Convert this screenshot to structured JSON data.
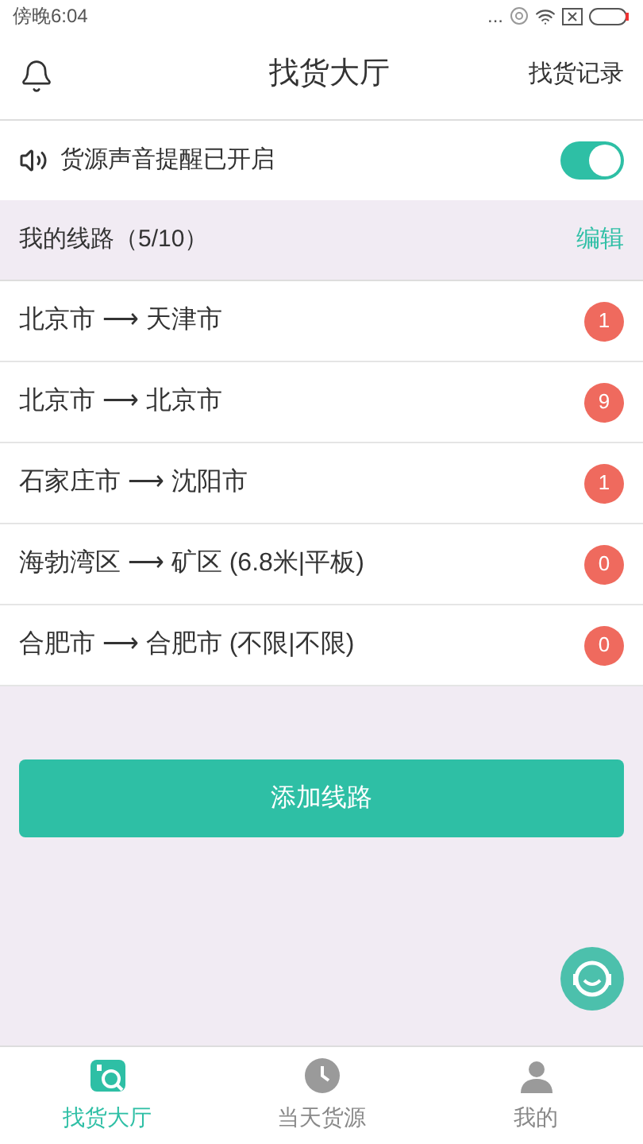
{
  "status_bar": {
    "time": "傍晚6:04",
    "dots": "..."
  },
  "header": {
    "title": "找货大厅",
    "action": "找货记录"
  },
  "sound_alert": {
    "label": "货源声音提醒已开启",
    "on": true
  },
  "routes_header": {
    "title": "我的线路（5/10）",
    "action": "编辑"
  },
  "routes": [
    {
      "label": "北京市 ⟶ 天津市",
      "count": "1"
    },
    {
      "label": "北京市 ⟶ 北京市",
      "count": "9"
    },
    {
      "label": "石家庄市 ⟶ 沈阳市",
      "count": "1"
    },
    {
      "label": "海勃湾区 ⟶ 矿区 (6.8米|平板)",
      "count": "0"
    },
    {
      "label": "合肥市 ⟶ 合肥市 (不限|不限)",
      "count": "0"
    }
  ],
  "add_button": "添加线路",
  "bottom_nav": [
    {
      "label": "找货大厅",
      "selected": true
    },
    {
      "label": "当天货源",
      "selected": false
    },
    {
      "label": "我的",
      "selected": false
    }
  ]
}
